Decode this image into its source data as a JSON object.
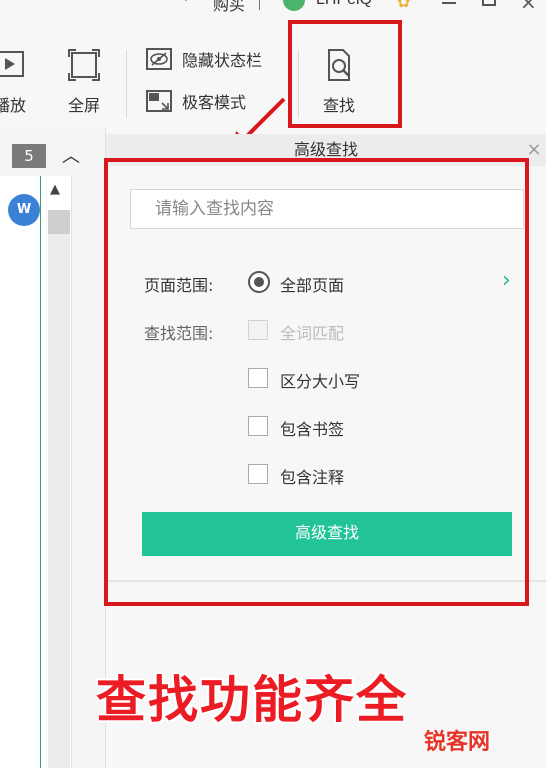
{
  "titlebar": {
    "vip_label": "购买",
    "username": "LHPeiQ"
  },
  "toolbar": {
    "play_label": "播放",
    "fullscreen_label": "全屏",
    "hide_statusbar_label": "隐藏状态栏",
    "geek_mode_label": "极客模式",
    "find_label": "查找"
  },
  "sidebar": {
    "page_number": "5"
  },
  "find_panel": {
    "title": "高级查找",
    "search_placeholder": "请输入查找内容",
    "page_range_label": "页面范围:",
    "page_range_value": "全部页面",
    "find_scope_label": "查找范围:",
    "options": [
      {
        "label": "全词匹配",
        "checked": false,
        "disabled": true
      },
      {
        "label": "区分大小写",
        "checked": false,
        "disabled": false
      },
      {
        "label": "包含书签",
        "checked": false,
        "disabled": false
      },
      {
        "label": "包含注释",
        "checked": false,
        "disabled": false
      }
    ],
    "submit_label": "高级查找"
  },
  "caption": "查找功能齐全",
  "watermark": "锐客网",
  "colors": {
    "highlight": "#d9181e",
    "accent": "#22c497",
    "caption": "#ec1c24"
  }
}
